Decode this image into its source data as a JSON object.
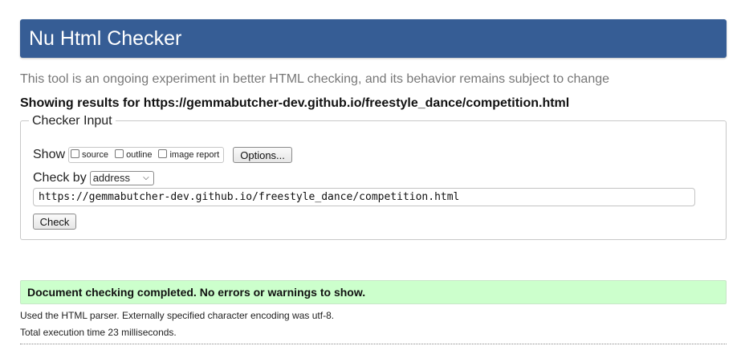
{
  "header": {
    "title": "Nu Html Checker",
    "background_color": "#365d95"
  },
  "intro_text": "This tool is an ongoing experiment in better HTML checking, and its behavior remains subject to change",
  "results_heading": "Showing results for https://gemmabutcher-dev.github.io/freestyle_dance/competition.html",
  "checker_input": {
    "legend": "Checker Input",
    "show_label": "Show",
    "show_options": [
      {
        "label": "source",
        "checked": false
      },
      {
        "label": "outline",
        "checked": false
      },
      {
        "label": "image report",
        "checked": false
      }
    ],
    "options_button": "Options...",
    "check_by_label": "Check by",
    "check_by_selected": "address",
    "url_value": "https://gemmabutcher-dev.github.io/freestyle_dance/competition.html",
    "check_button": "Check"
  },
  "result": {
    "message": "Document checking completed. No errors or warnings to show.",
    "background_color": "#ccffcc"
  },
  "info_lines": [
    "Used the HTML parser. Externally specified character encoding was utf-8.",
    "Total execution time 23 milliseconds."
  ]
}
